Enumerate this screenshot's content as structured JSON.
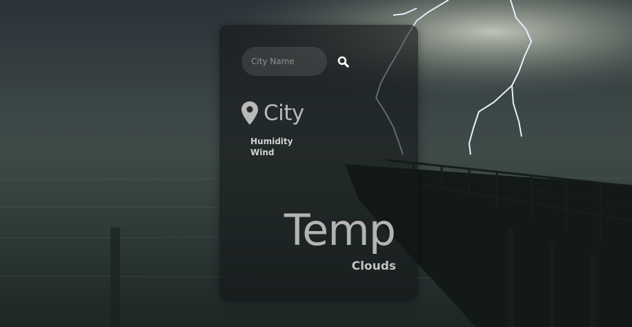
{
  "search": {
    "placeholder": "City Name",
    "button_icon": "search-icon"
  },
  "location": {
    "icon": "map-pin-icon",
    "city": "City"
  },
  "details": {
    "humidity_label": "Humidity",
    "wind_label": "Wind"
  },
  "weather": {
    "temp_label": "Temp",
    "description": "Clouds"
  },
  "colors": {
    "card_bg": "#141618",
    "text_light": "#d2d2d2",
    "text_muted": "#b4b4b4"
  }
}
